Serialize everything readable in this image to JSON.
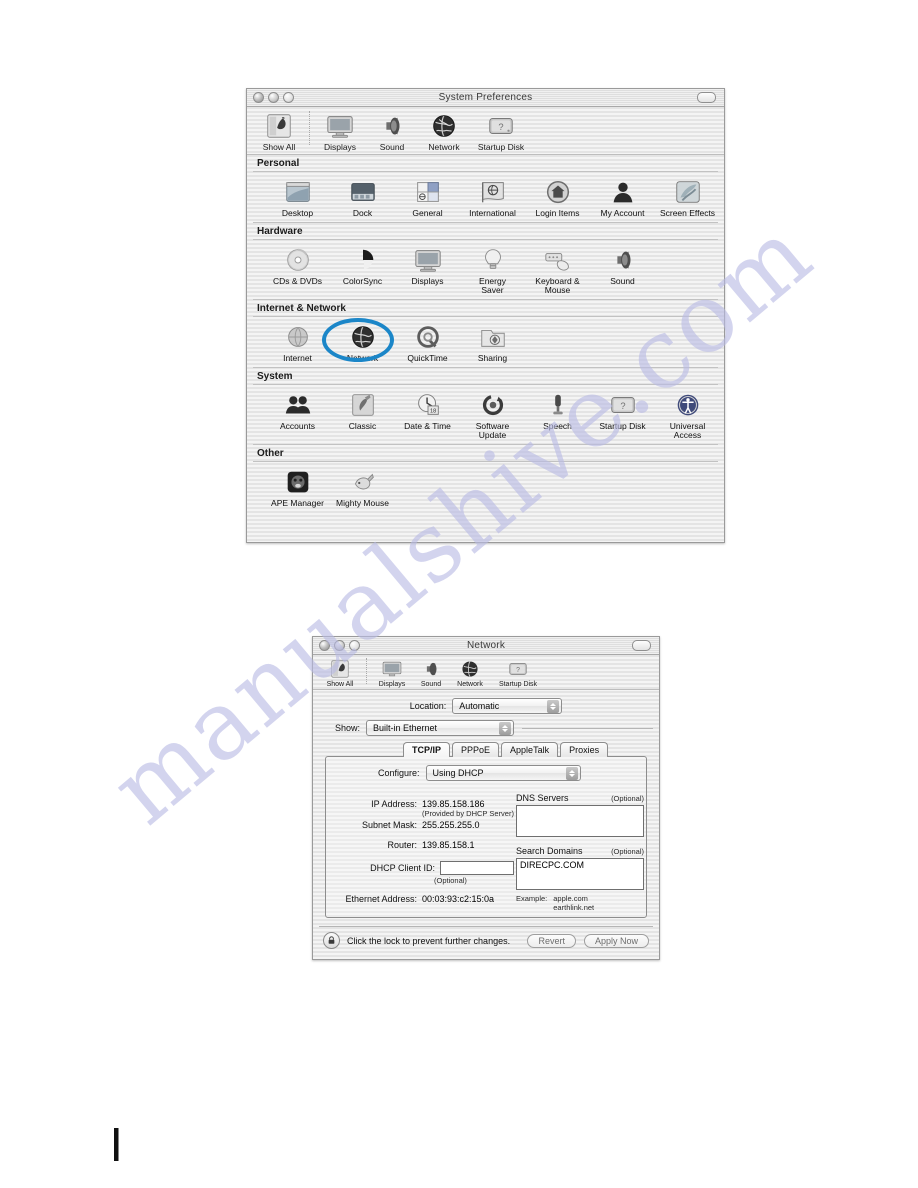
{
  "watermark": {
    "text": "manualshive.com",
    "color": "#b9bbe4"
  },
  "accent": {
    "highlight_ring": "#1b86c8"
  },
  "system_preferences_window": {
    "title": "System Preferences",
    "window_controls": {
      "close": "close-button",
      "minimize": "minimize-button",
      "zoom": "zoom-button",
      "toolbar_toggle": "toolbar-toggle-button"
    },
    "toolbar": [
      {
        "label": "Show All",
        "icon": "show-all-icon"
      },
      {
        "label": "Displays",
        "icon": "displays-icon"
      },
      {
        "label": "Sound",
        "icon": "sound-icon"
      },
      {
        "label": "Network",
        "icon": "network-globe-icon"
      },
      {
        "label": "Startup Disk",
        "icon": "startup-disk-icon"
      }
    ],
    "groups": [
      {
        "title": "Personal",
        "items": [
          {
            "label": "Desktop",
            "icon": "desktop-icon"
          },
          {
            "label": "Dock",
            "icon": "dock-icon"
          },
          {
            "label": "General",
            "icon": "general-icon"
          },
          {
            "label": "International",
            "icon": "international-flag-icon"
          },
          {
            "label": "Login Items",
            "icon": "login-items-home-icon"
          },
          {
            "label": "My Account",
            "icon": "my-account-person-icon"
          },
          {
            "label": "Screen Effects",
            "icon": "screen-effects-icon"
          }
        ]
      },
      {
        "title": "Hardware",
        "items": [
          {
            "label": "CDs & DVDs",
            "icon": "cd-disc-icon"
          },
          {
            "label": "ColorSync",
            "icon": "colorsync-icon"
          },
          {
            "label": "Displays",
            "icon": "displays-icon"
          },
          {
            "label": "Energy\nSaver",
            "icon": "lightbulb-icon"
          },
          {
            "label": "Keyboard &\nMouse",
            "icon": "keyboard-mouse-icon"
          },
          {
            "label": "Sound",
            "icon": "sound-icon"
          }
        ]
      },
      {
        "title": "Internet & Network",
        "items": [
          {
            "label": "Internet",
            "icon": "internet-globe-icon",
            "highlighted": false
          },
          {
            "label": "Network",
            "icon": "network-globe-icon",
            "highlighted": true
          },
          {
            "label": "QuickTime",
            "icon": "quicktime-icon"
          },
          {
            "label": "Sharing",
            "icon": "sharing-folder-icon"
          }
        ]
      },
      {
        "title": "System",
        "items": [
          {
            "label": "Accounts",
            "icon": "accounts-people-icon"
          },
          {
            "label": "Classic",
            "icon": "classic-icon"
          },
          {
            "label": "Date & Time",
            "icon": "date-time-clock-icon"
          },
          {
            "label": "Software\nUpdate",
            "icon": "software-update-icon"
          },
          {
            "label": "Speech",
            "icon": "speech-microphone-icon"
          },
          {
            "label": "Startup Disk",
            "icon": "startup-disk-icon"
          },
          {
            "label": "Universal\nAccess",
            "icon": "universal-access-icon"
          }
        ]
      },
      {
        "title": "Other",
        "items": [
          {
            "label": "APE Manager",
            "icon": "ape-manager-icon"
          },
          {
            "label": "Mighty Mouse",
            "icon": "mighty-mouse-icon"
          }
        ]
      }
    ]
  },
  "network_window": {
    "title": "Network",
    "toolbar": [
      {
        "label": "Show All",
        "icon": "show-all-icon"
      },
      {
        "label": "Displays",
        "icon": "displays-icon"
      },
      {
        "label": "Sound",
        "icon": "sound-icon"
      },
      {
        "label": "Network",
        "icon": "network-globe-icon"
      },
      {
        "label": "Startup Disk",
        "icon": "startup-disk-icon"
      }
    ],
    "location": {
      "label": "Location:",
      "value": "Automatic"
    },
    "show": {
      "label": "Show:",
      "value": "Built-in Ethernet"
    },
    "tabs": [
      {
        "label": "TCP/IP",
        "active": true
      },
      {
        "label": "PPPoE",
        "active": false
      },
      {
        "label": "AppleTalk",
        "active": false
      },
      {
        "label": "Proxies",
        "active": false
      }
    ],
    "tcpip": {
      "configure_label": "Configure:",
      "configure_value": "Using DHCP",
      "ip_address_label": "IP Address:",
      "ip_address_value": "139.85.158.186",
      "ip_address_note": "(Provided by DHCP Server)",
      "subnet_mask_label": "Subnet Mask:",
      "subnet_mask_value": "255.255.255.0",
      "router_label": "Router:",
      "router_value": "139.85.158.1",
      "dhcp_client_id_label": "DHCP Client ID:",
      "dhcp_client_id_value": "",
      "dhcp_client_id_note": "(Optional)",
      "ethernet_address_label": "Ethernet Address:",
      "ethernet_address_value": "00:03:93:c2:15:0a",
      "dns_servers_label": "DNS Servers",
      "dns_servers_optional": "(Optional)",
      "dns_servers_value": "",
      "search_domains_label": "Search Domains",
      "search_domains_optional": "(Optional)",
      "search_domains_value": "DIRECPC.COM",
      "example_label": "Example:",
      "example_line1": "apple.com",
      "example_line2": "earthlink.net"
    },
    "footer": {
      "lock_text": "Click the lock to prevent further changes.",
      "revert_label": "Revert",
      "apply_label": "Apply Now"
    }
  }
}
